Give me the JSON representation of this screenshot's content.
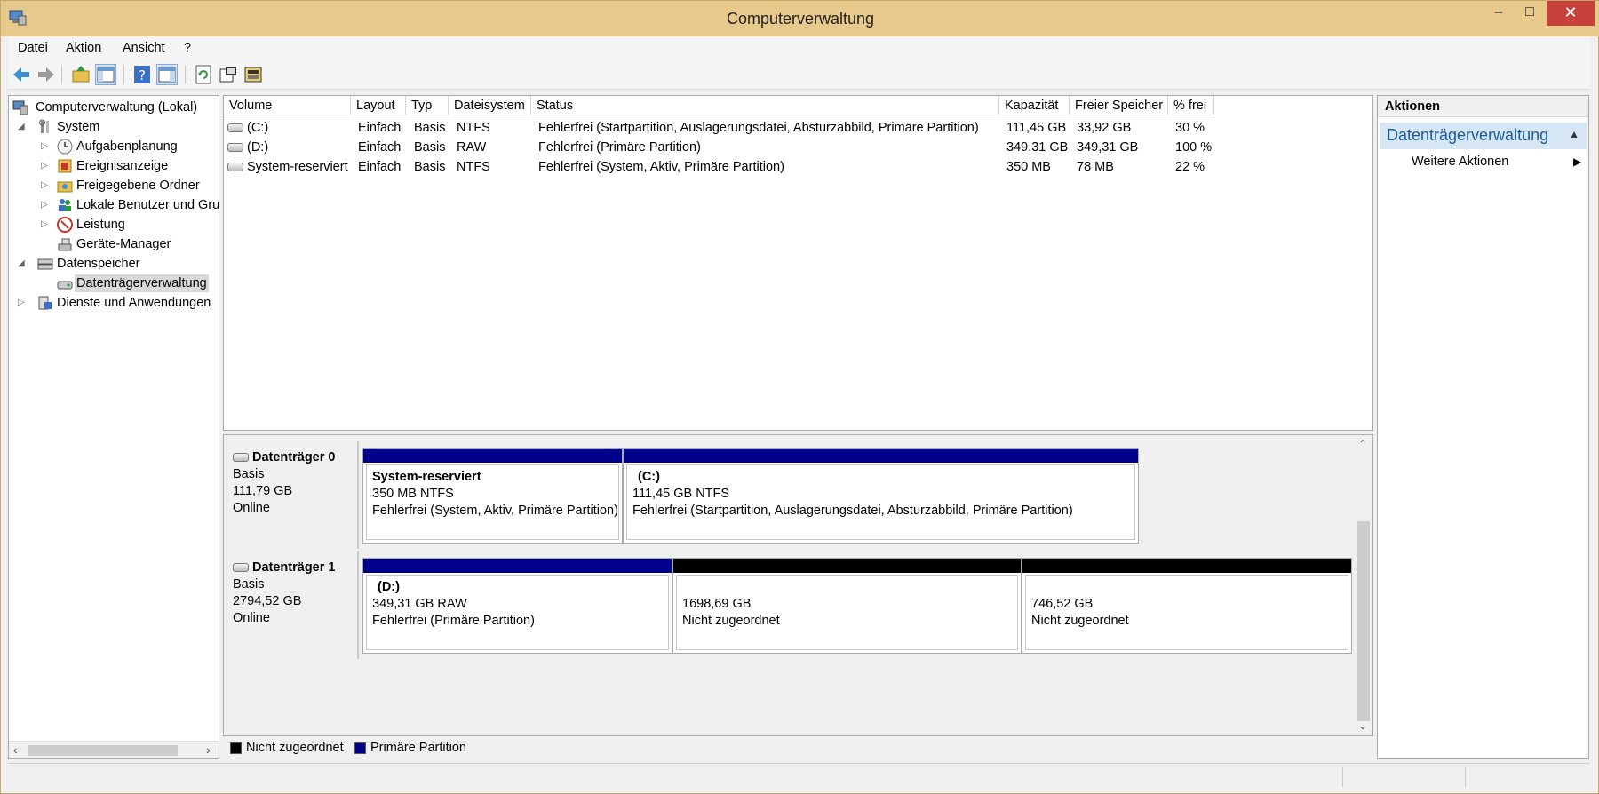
{
  "window": {
    "title": "Computerverwaltung",
    "min": "–",
    "max": "□",
    "close": "✕"
  },
  "menu": [
    "Datei",
    "Aktion",
    "Ansicht",
    "?"
  ],
  "tree": {
    "root": "Computerverwaltung (Lokal)",
    "system": "System",
    "aufgaben": "Aufgabenplanung",
    "ereignis": "Ereignisanzeige",
    "freigaben": "Freigegebene Ordner",
    "benutzer": "Lokale Benutzer und Gruppen",
    "leistung": "Leistung",
    "geraete": "Geräte-Manager",
    "datenspeicher": "Datenspeicher",
    "datentraeger": "Datenträgerverwaltung",
    "dienste": "Dienste und Anwendungen"
  },
  "volumes": {
    "headers": [
      "Volume",
      "Layout",
      "Typ",
      "Dateisystem",
      "Status",
      "Kapazität",
      "Freier Speicher",
      "% frei"
    ],
    "rows": [
      [
        "(C:)",
        "Einfach",
        "Basis",
        "NTFS",
        "Fehlerfrei (Startpartition, Auslagerungsdatei, Absturzabbild, Primäre Partition)",
        "111,45 GB",
        "33,92 GB",
        "30 %"
      ],
      [
        "(D:)",
        "Einfach",
        "Basis",
        "RAW",
        "Fehlerfrei (Primäre Partition)",
        "349,31 GB",
        "349,31 GB",
        "100 %"
      ],
      [
        "System-reserviert",
        "Einfach",
        "Basis",
        "NTFS",
        "Fehlerfrei (System, Aktiv, Primäre Partition)",
        "350 MB",
        "78 MB",
        "22 %"
      ]
    ]
  },
  "disks": [
    {
      "name": "Datenträger 0",
      "type": "Basis",
      "size": "111,79 GB",
      "state": "Online",
      "partitions": [
        {
          "title": "System-reserviert",
          "line1": "350 MB NTFS",
          "line2": "Fehlerfrei (System, Aktiv, Primäre Partition)",
          "kind": "primary"
        },
        {
          "title": "(C:)",
          "line1": "111,45 GB NTFS",
          "line2": "Fehlerfrei (Startpartition, Auslagerungsdatei, Absturzabbild, Primäre Partition)",
          "kind": "primary"
        }
      ]
    },
    {
      "name": "Datenträger 1",
      "type": "Basis",
      "size": "2794,52 GB",
      "state": "Online",
      "partitions": [
        {
          "title": "(D:)",
          "line1": "349,31 GB RAW",
          "line2": "Fehlerfrei (Primäre Partition)",
          "kind": "primary"
        },
        {
          "title": "",
          "line1": "1698,69 GB",
          "line2": "Nicht zugeordnet",
          "kind": "unallocated"
        },
        {
          "title": "",
          "line1": "746,52 GB",
          "line2": "Nicht zugeordnet",
          "kind": "unallocated"
        }
      ]
    }
  ],
  "legend": {
    "unallocated": "Nicht zugeordnet",
    "primary": "Primäre Partition"
  },
  "actions": {
    "header": "Aktionen",
    "section": "Datenträgerverwaltung",
    "more": "Weitere Aktionen"
  },
  "colors": {
    "primary": "#00008b",
    "unallocated": "#000000",
    "titlebar": "#e8c98c"
  }
}
